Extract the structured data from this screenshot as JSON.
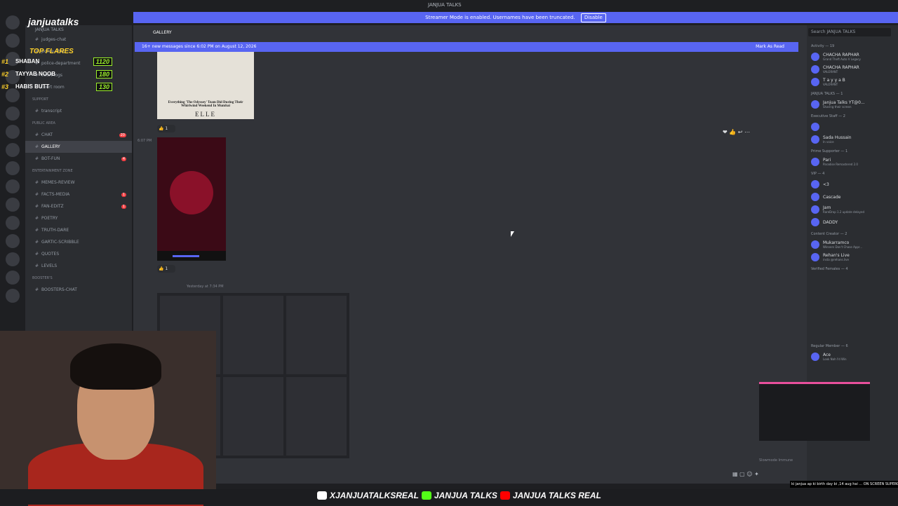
{
  "window": {
    "title": "JANJUA TALKS"
  },
  "streamer_banner": {
    "text": "Streamer Mode is enabled. Usernames have been truncated.",
    "button": "Disable"
  },
  "overlay": {
    "channel_title": "janjuatalks",
    "flares_title": "TOP FLARES",
    "flares": [
      {
        "rank": "#1",
        "name": "SHABAN",
        "score": "1120"
      },
      {
        "rank": "#2",
        "name": "TAYYAB NOOB",
        "score": "180"
      },
      {
        "rank": "#3",
        "name": "HABIS BUTT",
        "score": "130"
      }
    ]
  },
  "sidebar": {
    "server_name": "JANJUA TALKS",
    "top_items": [
      "judges-chat",
      "police-chat",
      "police-department",
      "court-logs",
      "Court room"
    ],
    "sections": [
      {
        "category": "SUPPORT",
        "channels": [
          {
            "name": "transcript"
          }
        ]
      },
      {
        "category": "PUBLIC AREA",
        "channels": [
          {
            "name": "CHAT",
            "badge": "20"
          },
          {
            "name": "GALLERY",
            "active": true
          },
          {
            "name": "BOT-FUN",
            "badge": "4"
          }
        ]
      },
      {
        "category": "ENTERTAINMENT ZONE",
        "channels": [
          {
            "name": "MEMES-REVIEW"
          },
          {
            "name": "FACTS-MEDIA",
            "badge": "1"
          },
          {
            "name": "FAN-EDITZ",
            "badge": "1"
          },
          {
            "name": "POETRY"
          },
          {
            "name": "TRUTH-DARE"
          },
          {
            "name": "GARTIC-SCRIBBLE"
          },
          {
            "name": "QUOTES"
          },
          {
            "name": "LEVELS"
          }
        ]
      },
      {
        "category": "BOOSTER'S",
        "channels": [
          {
            "name": "BOOSTERS-CHAT"
          }
        ]
      }
    ]
  },
  "chat": {
    "channel": "GALLERY",
    "new_messages": "16+ new messages since 6:02 PM on August 12, 2026",
    "mark_as_read": "Mark As Read",
    "article_caption": "Everything 'The Odyssey' Team Did During Their Whirlwind Weekend In Mumbai",
    "article_brand": "ELLE",
    "reaction_count_1": "1",
    "reaction_count_2": "1",
    "time_1": "6:07 PM",
    "msg_time": "Yesterday at 7:34 PM",
    "slowmode": "Slowmode Immune"
  },
  "members": {
    "search_placeholder": "Search JANJUA TALKS",
    "activity": "Activity — 19",
    "activities": [
      {
        "name": "CHACHA RAPHAR",
        "sub": "Grand Theft Auto V Legacy"
      },
      {
        "name": "CHACHA RAPHAR",
        "sub": "VALORANT"
      },
      {
        "name": "T a y y a B",
        "sub": "VALORANT"
      }
    ],
    "groups": [
      {
        "title": "JANJUA TALKS — 1",
        "members": [
          {
            "name": "Janjua Talks YT@0...",
            "sub": "Sharing their screen"
          }
        ]
      },
      {
        "title": "Executive Staff — 2",
        "members": [
          {
            "name": "",
            "sub": ""
          },
          {
            "name": "Sada Hussain",
            "sub": "In voice"
          }
        ]
      },
      {
        "title": "Prime Supporter — 1",
        "members": [
          {
            "name": "Pari",
            "sub": "Paradise Remastered 2.0"
          }
        ]
      },
      {
        "title": "VIP — 4",
        "members": [
          {
            "name": "<3",
            "sub": ""
          },
          {
            "name": "Cascade",
            "sub": ""
          },
          {
            "name": "Jam",
            "sub": "RareDrop 1.2 update delayed"
          },
          {
            "name": "DADDY",
            "sub": ""
          }
        ]
      },
      {
        "title": "Content Creator — 2",
        "members": [
          {
            "name": "Mukarramco",
            "sub": "Winners Don't Chase Appr..."
          },
          {
            "name": "Rehan's Live",
            "sub": "insta @rehans.live"
          }
        ]
      },
      {
        "title": "Verified Females — 4",
        "members": []
      },
      {
        "title": "Regular Member — 6",
        "members": [
          {
            "name": "Ace",
            "sub": "Look Nah I'd Win"
          },
          {
            "name": "BASIT",
            "sub": "In voice"
          }
        ]
      }
    ]
  },
  "stream_overlay": {
    "socials": [
      "XJANJUATALKSREAL",
      "JANJUA TALKS",
      "JANJUA TALKS REAL"
    ],
    "ticker": "ki janjua ap ki birth day bi ,14 aug hai ... ON SCREEN SUPERCHAT 1000+ PKR"
  },
  "colors": {
    "accent": "#5865f2",
    "flare_yellow": "#ffd12a",
    "flare_green": "#9bf02a",
    "badge_red": "#f23f43"
  }
}
